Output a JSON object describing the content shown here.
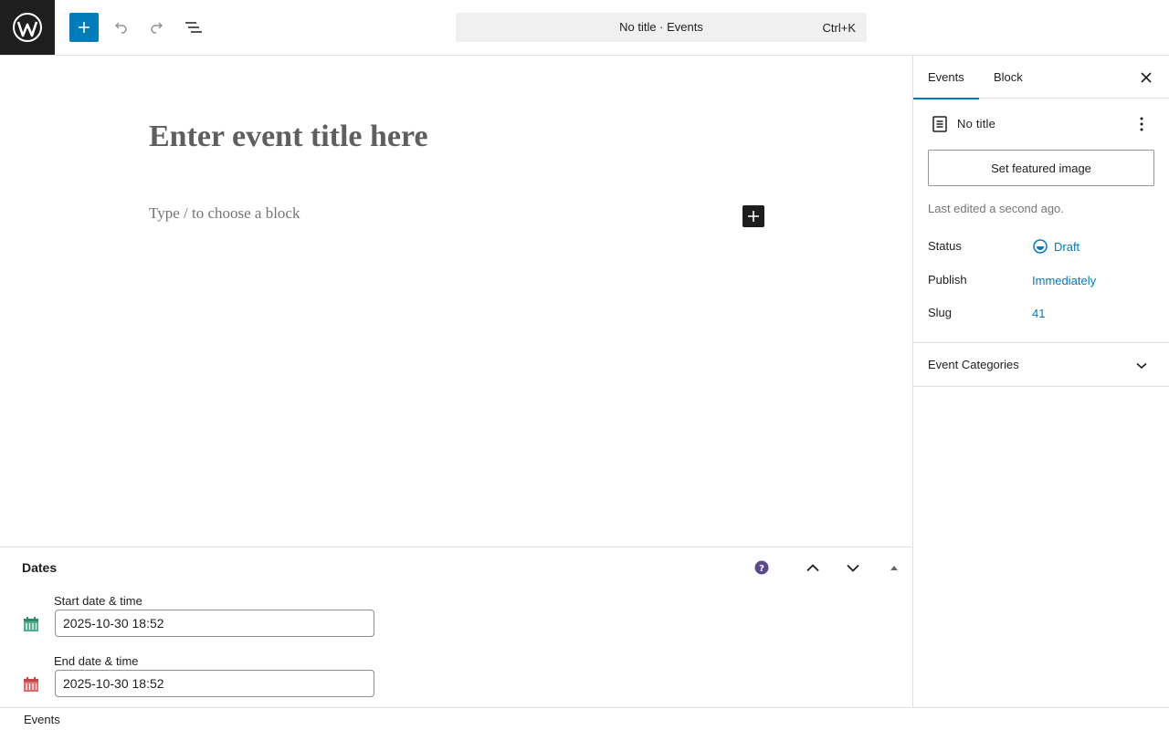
{
  "topbar": {
    "icons": {
      "logo": "wordpress-logo",
      "add": "plus-icon",
      "undo": "undo-icon",
      "redo": "redo-icon",
      "outline": "document-overview-icon"
    },
    "command_bar": {
      "title": "No title · Events",
      "shortcut": "Ctrl+K"
    }
  },
  "editor": {
    "title_placeholder": "Enter event title here",
    "block_placeholder": "Type / to choose a block"
  },
  "sidebar": {
    "tabs": [
      {
        "label": "Events",
        "active": true
      },
      {
        "label": "Block",
        "active": false
      }
    ],
    "post_card": {
      "title": "No title"
    },
    "featured_image_button": "Set featured image",
    "last_edited": "Last edited a second ago.",
    "meta": {
      "status_label": "Status",
      "status_value": "Draft",
      "publish_label": "Publish",
      "publish_value": "Immediately",
      "slug_label": "Slug",
      "slug_value": "41"
    },
    "panels": [
      {
        "title": "Event Categories",
        "expanded": false
      }
    ]
  },
  "metabox": {
    "title": "Dates",
    "start_label": "Start date & time",
    "start_value": "2025-10-30 18:52",
    "end_label": "End date & time",
    "end_value": "2025-10-30 18:52"
  },
  "footer": {
    "breadcrumb": "Events"
  },
  "colors": {
    "accent": "#007cba",
    "dark": "#1e1e1e",
    "start_calendar": "#4caf8a",
    "end_calendar": "#e06c6c",
    "help_icon": "#5b4a8b"
  }
}
